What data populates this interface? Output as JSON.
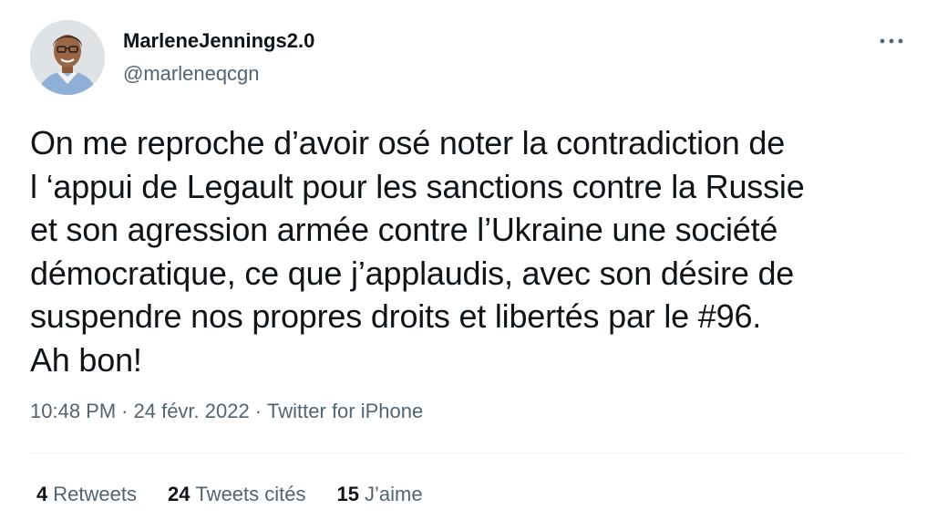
{
  "author": {
    "display_name": "MarleneJennings2.0",
    "handle": "@marleneqcgn"
  },
  "icons": {
    "more": "more-horizontal-icon",
    "avatar": "profile-photo"
  },
  "tweet": {
    "text": "On me reproche d’avoir osé noter la contradiction de\nl ‘appui de Legault pour les sanctions contre la Russie\net son agression armée contre l’Ukraine une société\ndémocratique, ce que j’applaudis, avec son désire de\nsuspendre nos propres droits et libertés par le #96.\nAh bon!"
  },
  "meta": {
    "time": "10:48 PM",
    "separator": "·",
    "date": "24 févr. 2022",
    "source": "Twitter for iPhone"
  },
  "stats": {
    "retweets_count": "4",
    "retweets_label": "Retweets",
    "quotes_count": "24",
    "quotes_label": "Tweets cités",
    "likes_count": "15",
    "likes_label": "J’aime"
  },
  "colors": {
    "text_primary": "#0f1419",
    "text_secondary": "#536471",
    "divider": "#eff3f4"
  }
}
